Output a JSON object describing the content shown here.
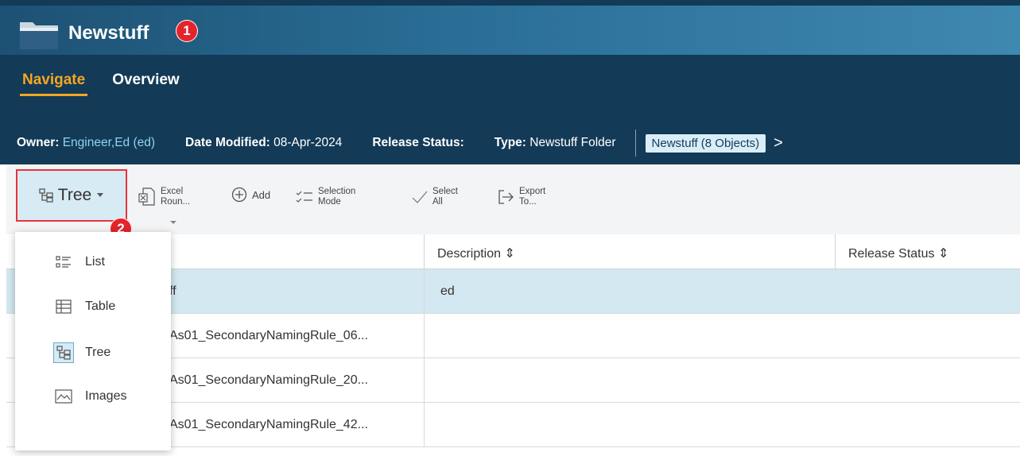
{
  "header": {
    "title": "Newstuff",
    "badge1": "1",
    "tabs": [
      {
        "label": "Navigate",
        "active": true
      },
      {
        "label": "Overview",
        "active": false
      }
    ],
    "info": {
      "owner_label": "Owner:",
      "owner_value": "Engineer,Ed (ed)",
      "date_label": "Date Modified:",
      "date_value": "08-Apr-2024",
      "release_label": "Release Status:",
      "type_label": "Type:",
      "type_value": "Newstuff Folder",
      "breadcrumb": "Newstuff (8 Objects)",
      "chevron": ">"
    }
  },
  "toolbar": {
    "view_label": "Tree",
    "badge2": "2",
    "excel_line1": "Excel",
    "excel_line2": "Roun...",
    "add_label": "Add",
    "selection_line1": "Selection",
    "selection_line2": "Mode",
    "select_line1": "Select",
    "select_line2": "All",
    "export_line1": "Export",
    "export_line2": "To..."
  },
  "view_menu": {
    "items": [
      {
        "label": "List",
        "icon": "list-icon"
      },
      {
        "label": "Table",
        "icon": "table-icon"
      },
      {
        "label": "Tree",
        "icon": "tree-icon",
        "selected": true
      },
      {
        "label": "Images",
        "icon": "images-icon"
      }
    ]
  },
  "table": {
    "columns": [
      "Description ⇕",
      "Release Status ⇕"
    ],
    "rows": [
      {
        "name": "ff",
        "description": "ed",
        "selected": true
      },
      {
        "name": "As01_SecondaryNamingRule_06...",
        "description": ""
      },
      {
        "name": "As01_SecondaryNamingRule_20...",
        "description": ""
      },
      {
        "name": "As01_SecondaryNamingRule_42...",
        "description": ""
      }
    ]
  },
  "colors": {
    "header_bg": "#133a56",
    "accent_tab": "#f5a623",
    "badge": "#e3242b",
    "selected_row": "#d3e8f0"
  }
}
